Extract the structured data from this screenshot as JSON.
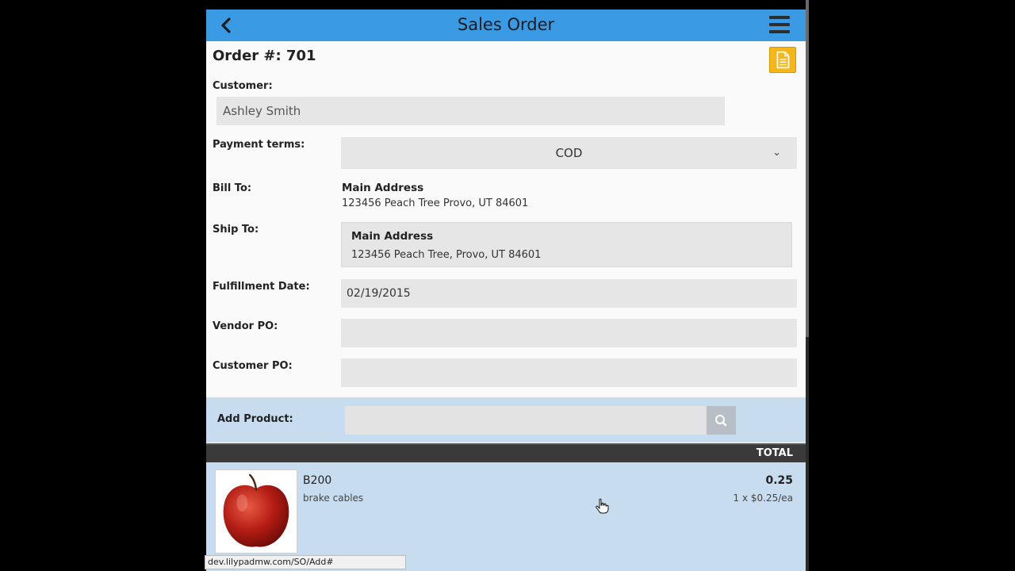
{
  "header": {
    "title": "Sales Order",
    "back_icon": "chevron-left-icon",
    "menu_icon": "hamburger-icon",
    "color": "#3a9ae4"
  },
  "order": {
    "label": "Order #: 701",
    "doc_icon": "document-icon",
    "doc_color": "#f5b61a"
  },
  "form": {
    "customer_label": "Customer:",
    "customer_value": "Ashley Smith",
    "payment_label": "Payment terms:",
    "payment_value": "COD",
    "bill_label": "Bill To:",
    "bill_name": "Main Address",
    "bill_address": "123456 Peach Tree Provo, UT 84601",
    "ship_label": "Ship To:",
    "ship_name": "Main Address",
    "ship_address": "123456 Peach Tree, Provo, UT 84601",
    "date_label": "Fulfillment Date:",
    "date_value": "02/19/2015",
    "vendor_label": "Vendor PO:",
    "vendor_value": "",
    "custpo_label": "Customer PO:",
    "custpo_value": ""
  },
  "add_product": {
    "label": "Add Product:",
    "placeholder": "",
    "search_icon": "search-icon"
  },
  "table": {
    "total_header": "TOTAL",
    "rows": [
      {
        "image": "apple-image",
        "sku": "B200",
        "description": "brake cables",
        "total": "0.25",
        "qty_price": "1 x $0.25/ea"
      }
    ]
  },
  "status_bar": {
    "url": "dev.lilypadmw.com/SO/Add#"
  }
}
